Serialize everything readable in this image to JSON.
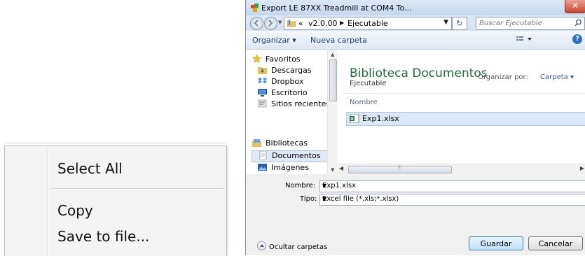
{
  "context_menu": {
    "items": [
      "Select All",
      "Copy",
      "Save to file..."
    ]
  },
  "dialog": {
    "title": "Export LE 87XX Treadmill at COM4 To...",
    "address": {
      "prefix": "«",
      "segments": [
        "v2.0.00",
        "Ejecutable"
      ]
    },
    "search_placeholder": "Buscar Ejecutable",
    "toolbar": {
      "organize": "Organizar ▾",
      "new_folder": "Nueva carpeta"
    },
    "nav": {
      "favorites_header": "Favoritos",
      "favorites": [
        "Descargas",
        "Dropbox",
        "Escritorio",
        "Sitios recientes"
      ],
      "libraries_header": "Bibliotecas",
      "libraries": [
        "Documentos",
        "Imágenes"
      ]
    },
    "library": {
      "title": "Biblioteca Documentos",
      "subtitle": "Ejecutable",
      "arrange_label": "Organizar por:",
      "arrange_value": "Carpeta ▾",
      "column": "Nombre",
      "files": [
        "Exp1.xlsx"
      ]
    },
    "form": {
      "name_label": "Nombre:",
      "name_value": "Exp1.xlsx",
      "type_label": "Tipo:",
      "type_value": "Excel file (*.xls;*.xlsx)"
    },
    "hide_folders": "Ocultar carpetas",
    "save_button": "Guardar",
    "cancel_button": "Cancelar",
    "colors": {
      "library_title": "#1e6e3a",
      "link_blue": "#2b5ab8",
      "selection": "#dbe8f7"
    }
  }
}
